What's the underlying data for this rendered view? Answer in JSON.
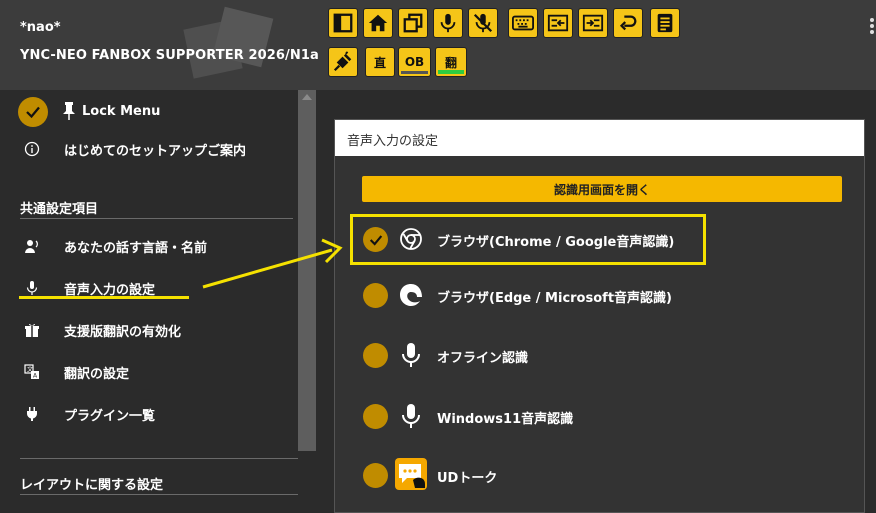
{
  "header": {
    "user_name": "*nao*",
    "plan_name": "YNC-NEO FANBOX SUPPORTER 2026/N1a",
    "toolbar_row1": [
      "sidebar-toggle-icon",
      "home-icon",
      "window-restore-icon",
      "microphone-icon",
      "microphone-off-icon",
      "keyboard-icon",
      "input-left-icon",
      "input-right-icon",
      "undo-icon",
      "document-icon"
    ],
    "toolbar_row2": {
      "plugin_icon": "plug-off-icon",
      "direct_label": "直",
      "ob_label": "OB",
      "translate_label": "翻"
    }
  },
  "sidebar": {
    "lock_menu_label": "Lock Menu",
    "setup_guide_label": "はじめてのセットアップご案内",
    "common_section": "共通設定項目",
    "items": [
      {
        "label": "あなたの話す言語・名前",
        "icon": "speaking-person-icon"
      },
      {
        "label": "音声入力の設定",
        "icon": "microphone-icon"
      },
      {
        "label": "支援版翻訳の有効化",
        "icon": "gift-icon"
      },
      {
        "label": "翻訳の設定",
        "icon": "translate-icon"
      },
      {
        "label": "プラグイン一覧",
        "icon": "plug-icon"
      }
    ],
    "layout_section": "レイアウトに関する設定"
  },
  "panel": {
    "title": "音声入力の設定",
    "open_button": "認識用画面を開く",
    "options": [
      {
        "label": "ブラウザ(Chrome / Google音声認識)",
        "icon": "chrome-icon",
        "selected": true
      },
      {
        "label": "ブラウザ(Edge / Microsoft音声認識)",
        "icon": "edge-icon",
        "selected": false
      },
      {
        "label": "オフライン認識",
        "icon": "microphone-icon",
        "selected": false
      },
      {
        "label": "Windows11音声認識",
        "icon": "microphone-icon",
        "selected": false
      },
      {
        "label": "UDトーク",
        "icon": "udtalk-chat-icon",
        "selected": false
      }
    ]
  },
  "colors": {
    "accent_yellow": "#f5c518",
    "check_gold": "#c08c00",
    "annotation_yellow": "#f5e100",
    "background": "#2b2b2b"
  }
}
